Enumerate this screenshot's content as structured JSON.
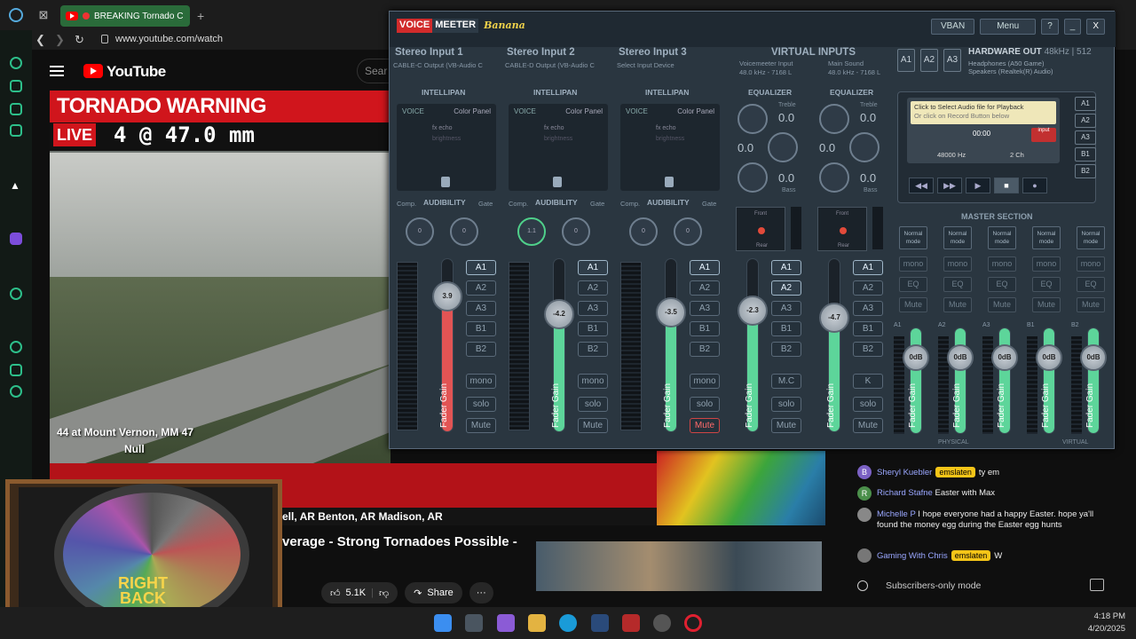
{
  "browser": {
    "tab_title": "BREAKING Tornado C",
    "url": "www.youtube.com/watch",
    "new_tab": "+"
  },
  "youtube": {
    "brand": "YouTube",
    "search_placeholder": "Sear",
    "video_title": "verage - Strong Tornadoes Possible -",
    "likes": "5.1K",
    "share_label": "Share",
    "more_label": "···"
  },
  "video": {
    "warning": "TORNADO WARNING",
    "live": "LIVE",
    "ticker": "4 @ 47.0  mm",
    "camera_label": "44 at Mount Vernon, MM 47",
    "camera_sub": "Null",
    "lower_text": "ell, AR   Benton, AR   Madison, AR"
  },
  "brb": {
    "line1": "RIGHT",
    "line2": "BACK"
  },
  "chat": {
    "messages": [
      {
        "initial": "B",
        "color": "#7b61c4",
        "name": "Sheryl Kuebler",
        "badge": "emslaten",
        "text": "ty em"
      },
      {
        "initial": "R",
        "color": "#4b8f4b",
        "name": "Richard Stafne",
        "badge": "",
        "text": "Easter with Max"
      },
      {
        "initial": "",
        "color": "#888888",
        "name": "Michelle P",
        "badge": "",
        "text": "I hope everyone had a happy Easter. hope ya'll found the money egg during the Easter egg hunts"
      },
      {
        "initial": "",
        "color": "#777777",
        "name": "Gaming With Chris",
        "badge": "emslaten",
        "text": "W"
      }
    ],
    "footer": "Subscribers-only mode"
  },
  "taskbar": {
    "time": "4:18 PM",
    "date": "4/20/2025"
  },
  "voicemeeter": {
    "logo_voice": "VOICE",
    "logo_meeter": "MEETER",
    "logo_edition": "Banana",
    "vban": "VBAN",
    "menu": "Menu",
    "help": "?",
    "minimize": "_",
    "close": "X",
    "strips": [
      {
        "name": "Stereo Input 1",
        "device": "CABLE-C Output (VB-Audio C",
        "gain": "3.9",
        "level": 0.78,
        "comp": "0",
        "gate": "0",
        "buses": [
          "A1",
          "A2",
          "A3",
          "B1",
          "B2",
          "mono",
          "solo",
          "Mute"
        ],
        "active": [
          "A1"
        ],
        "muted": false,
        "red": true
      },
      {
        "name": "Stereo Input 2",
        "device": "CABLE-D Output (VB-Audio C",
        "gain": "-4.2",
        "level": 0.68,
        "comp": "1.1",
        "gate": "0",
        "buses": [
          "A1",
          "A2",
          "A3",
          "B1",
          "B2",
          "mono",
          "solo",
          "Mute"
        ],
        "active": [
          "A1"
        ],
        "muted": false,
        "red": false
      },
      {
        "name": "Stereo Input 3",
        "device": "Select Input Device",
        "gain": "-3.5",
        "level": 0.69,
        "comp": "0",
        "gate": "0",
        "buses": [
          "A1",
          "A2",
          "A3",
          "B1",
          "B2",
          "mono",
          "solo",
          "Mute"
        ],
        "active": [
          "A1"
        ],
        "muted": true,
        "red": false
      }
    ],
    "intellipan": {
      "label": "INTELLIPAN",
      "voice": "VOICE",
      "color_panel": "Color Panel",
      "fx": "fx echo",
      "brightness": "brightness"
    },
    "audibility": {
      "label": "AUDIBILITY",
      "comp": "Comp.",
      "gate": "Gate"
    },
    "fader_label": "Fader Gain",
    "virtual": {
      "header": "VIRTUAL INPUTS",
      "names": [
        "Voicemeeter Input",
        "Main Sound"
      ],
      "rates": [
        "48.0 kHz - 7168 L",
        "48.0 kHz - 7168 L"
      ],
      "eq_label": "EQUALIZER",
      "treble": "Treble",
      "bass": "Bass",
      "eq_values": [
        [
          "0.0",
          "0.0",
          "0.0"
        ],
        [
          "0.0",
          "0.0",
          "0.0"
        ]
      ],
      "pan_top": "Front",
      "pan_bottom": "Rear",
      "gains": [
        "-2.3",
        "-4.7"
      ],
      "levels": [
        0.7,
        0.66
      ],
      "buses": [
        [
          "A1",
          "A2",
          "A3",
          "B1",
          "B2",
          "M.C",
          "solo",
          "Mute"
        ],
        [
          "A1",
          "A2",
          "A3",
          "B1",
          "B2",
          "K",
          "solo",
          "Mute"
        ]
      ],
      "active": [
        [
          "A1",
          "A2"
        ],
        [
          "A1"
        ]
      ]
    },
    "hardware": {
      "a_buttons": [
        "A1",
        "A2",
        "A3"
      ],
      "header": "HARDWARE OUT",
      "rate": "48kHz | 512",
      "device1": "Headphones (A50 Game)",
      "device2": "Speakers (Realtek(R) Audio)"
    },
    "recorder": {
      "note1": "Click to Select Audio file for Playback",
      "note2": "Or click on Record Button below",
      "time": "00:00",
      "input": "input",
      "hz": "48000 Hz",
      "ch": "2 Ch",
      "buses": [
        "A1",
        "A2",
        "A3",
        "B1",
        "B2"
      ]
    },
    "master": {
      "label": "MASTER SECTION",
      "mode": "Normal mode",
      "buttons": [
        "mono",
        "EQ",
        "Mute"
      ],
      "buses": [
        "A1",
        "A2",
        "A3",
        "B1",
        "B2"
      ],
      "gain": "0dB",
      "footer_left": "PHYSICAL",
      "footer_right": "VIRTUAL"
    }
  }
}
